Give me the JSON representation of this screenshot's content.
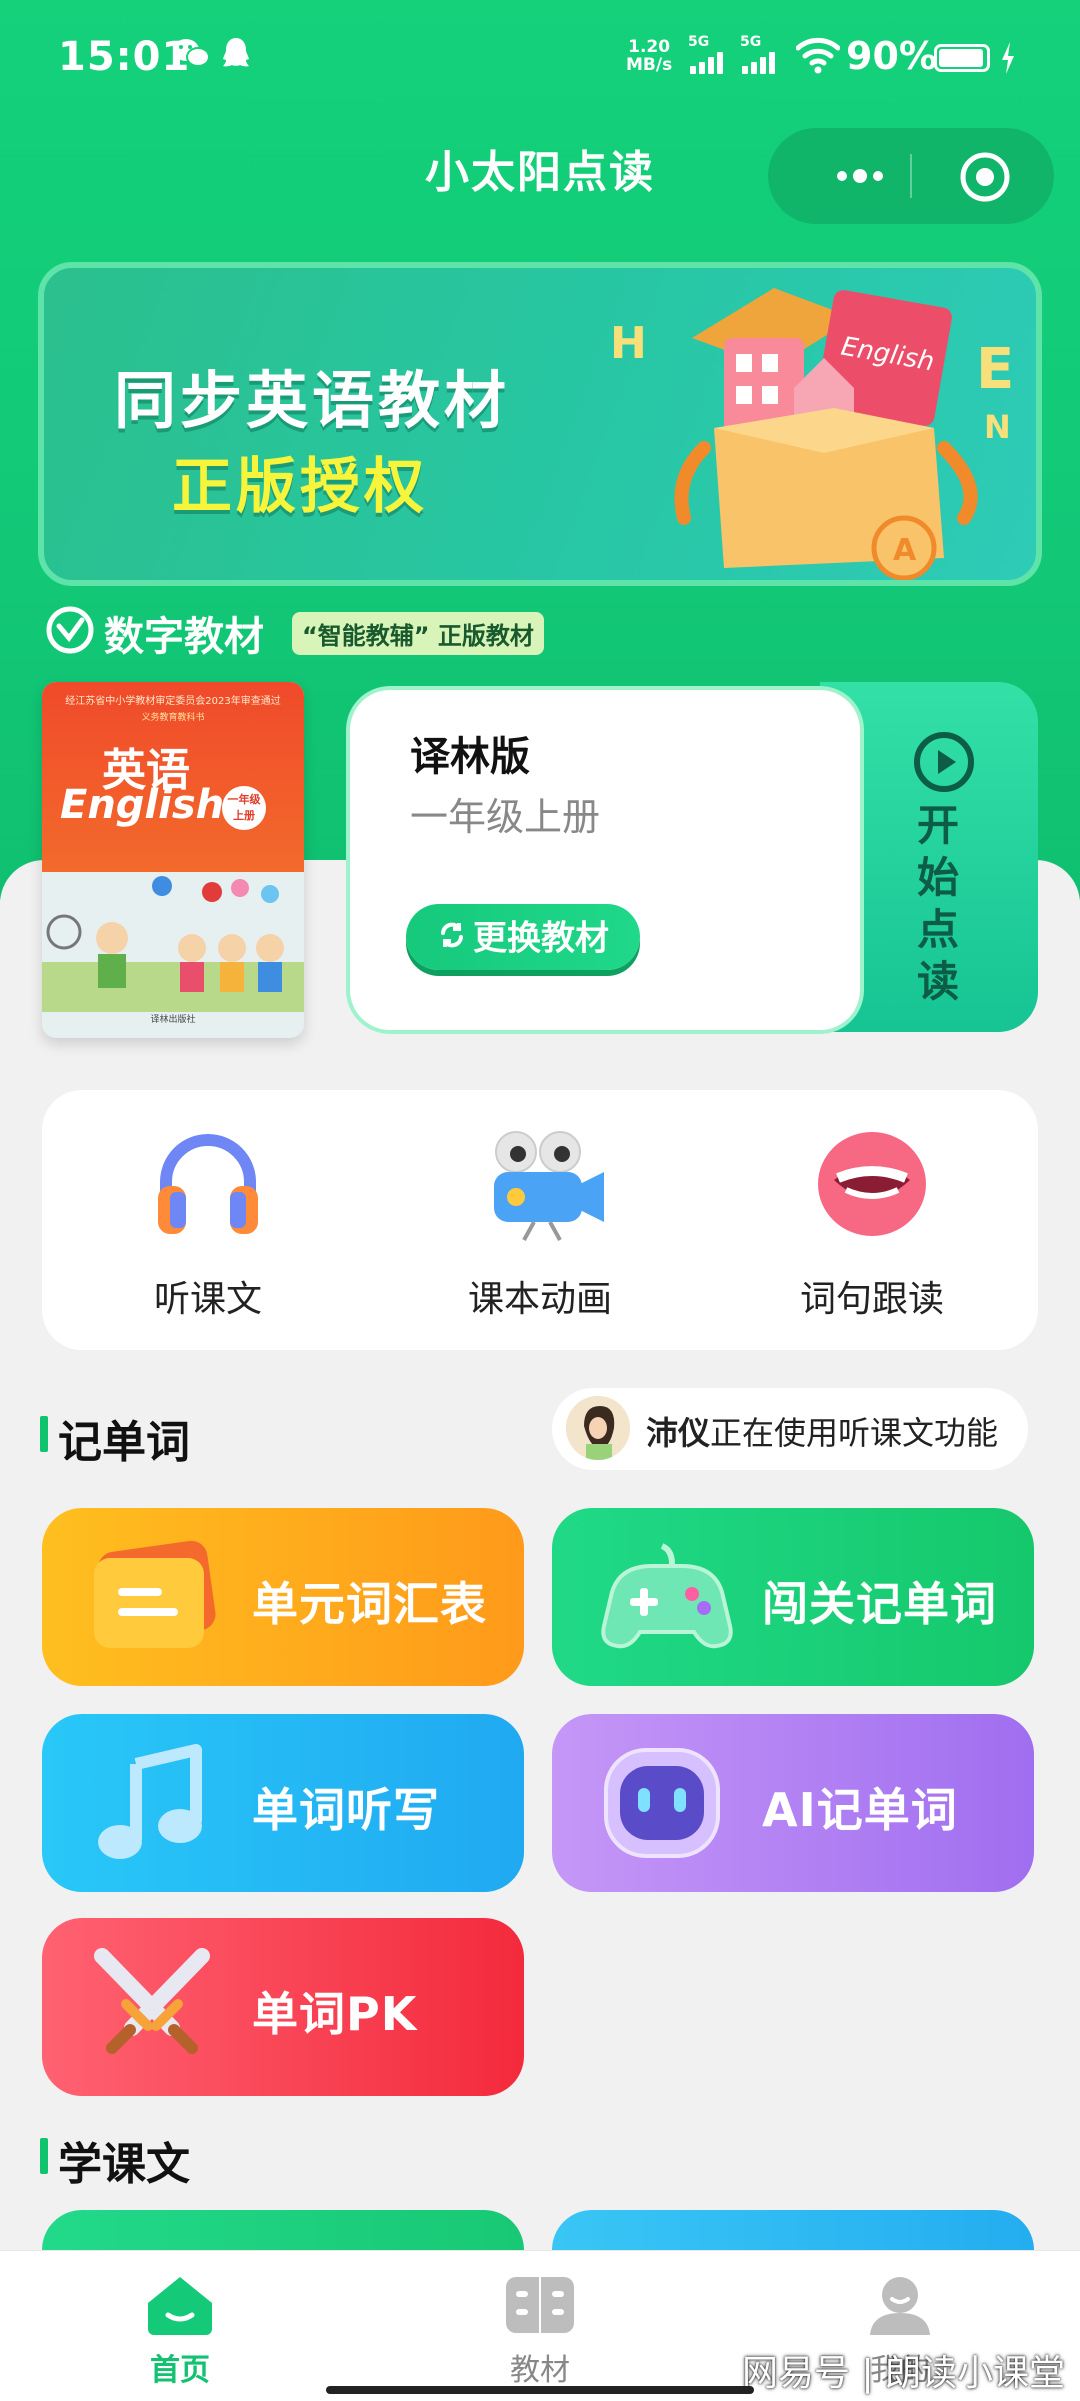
{
  "status_bar": {
    "time": "15:01",
    "net_speed_value": "1.20",
    "net_speed_unit": "MB/s",
    "sim1_label": "5G",
    "sim2_label": "5G",
    "battery_percent": "90%",
    "icons": [
      "wechat-icon",
      "qq-icon",
      "wifi-icon",
      "battery-icon",
      "charging-icon"
    ]
  },
  "header": {
    "title": "小太阳点读"
  },
  "banner": {
    "title": "同步英语教材",
    "subtitle": "正版授权",
    "decor_letters": [
      "H",
      "E",
      "N"
    ],
    "book_word": "English",
    "coin_letter": "A"
  },
  "digital_material": {
    "label": "数字教材",
    "tag": "“智能教辅” 正版教材"
  },
  "textbook": {
    "cover": {
      "publisher_line": "经江苏省中小学教材审定委员会2023年审查通过",
      "series_line": "义务教育教科书",
      "title_cn": "英语",
      "title_en": "English",
      "grade_badge": "一年级 上册",
      "footer": "译林出版社"
    },
    "edition": "译林版",
    "grade": "一年级上册",
    "change_button": "更换教材",
    "start_label": "开始点读"
  },
  "features": [
    {
      "label": "听课文",
      "icon": "headphones-icon"
    },
    {
      "label": "课本动画",
      "icon": "camera-icon"
    },
    {
      "label": "词句跟读",
      "icon": "lips-icon"
    }
  ],
  "vocab_section": {
    "title": "记单词",
    "live_user": "沛仪",
    "live_text": "正在使用听课文功能",
    "tiles": [
      {
        "label": "单元词汇表",
        "icon": "card-icon",
        "color_from": "#ffb21a",
        "color_to": "#ff8f1f"
      },
      {
        "label": "闯关记单词",
        "icon": "gamepad-icon",
        "color_from": "#22d77e",
        "color_to": "#17c86e"
      },
      {
        "label": "单词听写",
        "icon": "music-note-icon",
        "color_from": "#25c2f7",
        "color_to": "#1fa8f0"
      },
      {
        "label": "AI记单词",
        "icon": "robot-icon",
        "color_from": "#b98cf5",
        "color_to": "#9a6cf0"
      },
      {
        "label": "单词PK",
        "icon": "crossed-swords-icon",
        "color_from": "#ff5b6b",
        "color_to": "#f32b3f"
      }
    ]
  },
  "lesson_section": {
    "title": "学课文"
  },
  "bottom_nav": {
    "items": [
      {
        "label": "首页",
        "icon": "home-icon",
        "active": true
      },
      {
        "label": "教材",
        "icon": "book-icon",
        "active": false
      },
      {
        "label": "我的",
        "icon": "user-icon",
        "active": false
      }
    ]
  },
  "watermark": "网易号 | 朗读小课堂"
}
